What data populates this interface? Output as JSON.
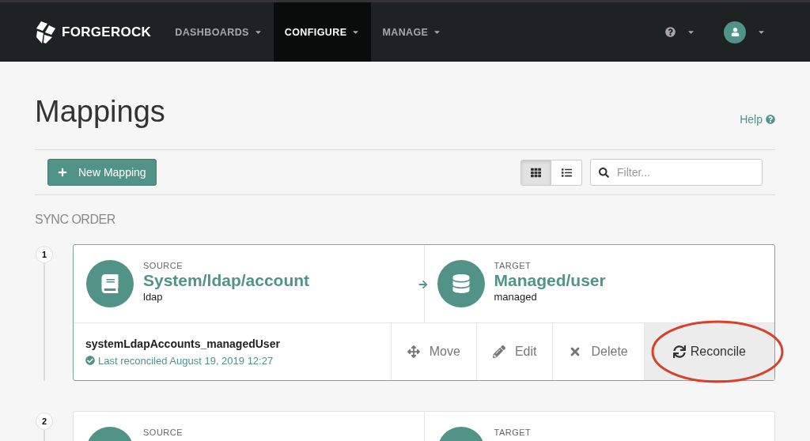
{
  "navbar": {
    "brand": "FORGEROCK",
    "menus": [
      {
        "label": "DASHBOARDS",
        "selected": false
      },
      {
        "label": "CONFIGURE",
        "selected": true
      },
      {
        "label": "MANAGE",
        "selected": false
      }
    ]
  },
  "page": {
    "title": "Mappings",
    "help": "Help"
  },
  "toolbar": {
    "new_button": "New Mapping",
    "views": [
      {
        "kind": "grid",
        "selected": true
      },
      {
        "kind": "list",
        "selected": false
      }
    ],
    "filter": {
      "placeholder": "Filter..."
    }
  },
  "section_title": "SYNC ORDER",
  "mappings": [
    {
      "number": "1",
      "source": {
        "label": "SOURCE",
        "name": "System/ldap/account",
        "type": "ldap"
      },
      "target": {
        "label": "TARGET",
        "name": "Managed/user",
        "type": "managed"
      },
      "mapping_name": "systemLdapAccounts_managedUser",
      "status": "Last reconciled August 19, 2019 12:27",
      "actions": [
        {
          "kind": "move",
          "label": "Move",
          "hovered": false,
          "circled": false
        },
        {
          "kind": "edit",
          "label": "Edit",
          "hovered": false,
          "circled": false
        },
        {
          "kind": "delete",
          "label": "Delete",
          "hovered": false,
          "circled": false
        },
        {
          "kind": "reconcile",
          "label": "Reconcile",
          "hovered": true,
          "circled": true
        }
      ]
    },
    {
      "number": "2",
      "source": {
        "label": "SOURCE"
      },
      "target": {
        "label": "TARGET"
      }
    }
  ]
}
